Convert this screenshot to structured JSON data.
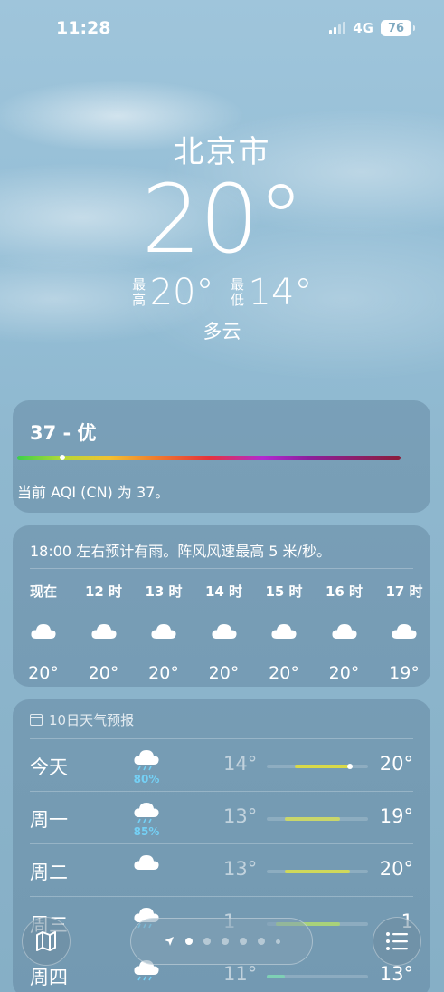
{
  "status": {
    "time": "11:28",
    "network": "4G",
    "battery": "76"
  },
  "header": {
    "city": "北京市",
    "temp": "20°",
    "high_label": "最高",
    "high": "20°",
    "low_label": "最低",
    "low": "14°",
    "condition": "多云"
  },
  "aqi": {
    "title": "37 - 优",
    "level": 37,
    "description": "当前 AQI (CN) 为 37。"
  },
  "hourly": {
    "note": "18:00 左右预计有雨。阵风风速最高 5 米/秒。",
    "items": [
      {
        "time": "现在",
        "temp": "20°",
        "icon": "cloud-icon"
      },
      {
        "time": "12 时",
        "temp": "20°",
        "icon": "cloud-icon"
      },
      {
        "time": "13 时",
        "temp": "20°",
        "icon": "cloud-icon"
      },
      {
        "time": "14 时",
        "temp": "20°",
        "icon": "cloud-icon"
      },
      {
        "time": "15 时",
        "temp": "20°",
        "icon": "cloud-icon"
      },
      {
        "time": "16 时",
        "temp": "20°",
        "icon": "cloud-icon"
      },
      {
        "time": "17 时",
        "temp": "19°",
        "icon": "cloud-icon"
      }
    ]
  },
  "daily": {
    "title": "10日天气预报",
    "items": [
      {
        "day": "今天",
        "icon": "rain-cloud-icon",
        "precip": "80%",
        "low": "14°",
        "high": "20°",
        "range_low": 14,
        "range_high": 20,
        "current": 20,
        "color": "#d9d948"
      },
      {
        "day": "周一",
        "icon": "rain-cloud-icon",
        "precip": "85%",
        "low": "13°",
        "high": "19°",
        "range_low": 13,
        "range_high": 19,
        "color": "#c9d66a"
      },
      {
        "day": "周二",
        "icon": "cloud-icon",
        "precip": "",
        "low": "13°",
        "high": "20°",
        "range_low": 13,
        "range_high": 20,
        "color": "#cfd85a"
      },
      {
        "day": "周三",
        "icon": "rain-cloud-icon",
        "precip": "",
        "low": "1",
        "high": "1",
        "range_low": 12,
        "range_high": 19,
        "color": "#a9d27a"
      },
      {
        "day": "周四",
        "icon": "rain-cloud-icon",
        "precip": "",
        "low": "11°",
        "high": "13°",
        "range_low": 11,
        "range_high": 13,
        "color": "#7ed0b5"
      }
    ]
  },
  "pager": {
    "pages": 7,
    "active": 1
  }
}
